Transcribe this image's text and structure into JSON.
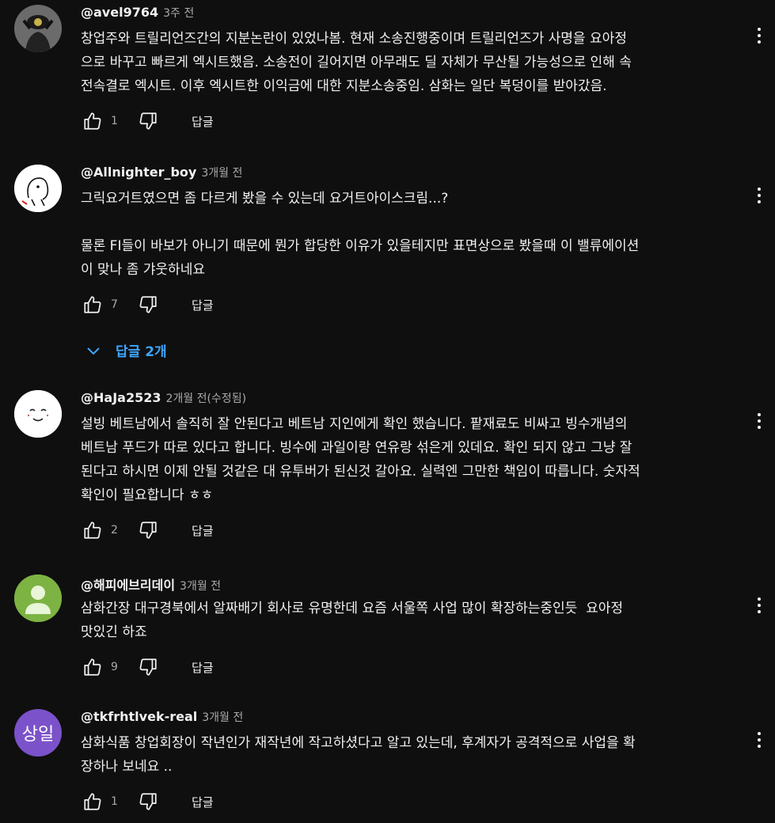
{
  "comments": [
    {
      "author": "@avel9764",
      "time": "3주 전",
      "text": "창업주와 트릴리언즈간의 지분논란이 있었나봄. 현재 소송진행중이며 트릴리언즈가 사명을 요아정\n으로 바꾸고 빠르게 엑시트했음. 소송전이 길어지면 아무래도 딜 자체가 무산될 가능성으로 인해 속\n전속결로 엑시트. 이후 엑시트한 이익금에 대한 지분소송중임. 삼화는 일단 복덩이를 받아갔음.",
      "likes": "1",
      "reply_label": "답글",
      "avatar_icon": "robot-figure-avatar"
    },
    {
      "author": "@Allnighter_boy",
      "time": "3개월 전",
      "text": "그릭요거트였으면 좀 다르게 봤을 수 있는데 요거트아이스크림...?\n\n물론 FI들이 바보가 아니기 때문에 뭔가 합당한 이유가 있을테지만 표면상으로 봤을때 이 밸류에이션\n이 맞나 좀 갸웃하네요",
      "likes": "7",
      "reply_label": "답글",
      "replies_label": "답글 2개",
      "avatar_icon": "doodle-character-avatar"
    },
    {
      "author": "@HaJa2523",
      "time": "2개월 전(수정됨)",
      "text": "설빙 베트남에서 솔직히 잘 안된다고 베트남 지인에게 확인 했습니다. 팥재료도 비싸고 빙수개념의\n베트남 푸드가 따로 있다고 합니다. 빙수에 과일이랑 연유랑 섞은게 있데요. 확인 되지 않고 그냥 잘\n된다고 하시면 이제 안될 것같은 대 유투버가 된신것 갈아요. 실력엔 그만한 책임이 따릅니다. 숫자적\n확인이 필요합니다 ㅎㅎ",
      "likes": "2",
      "reply_label": "답글",
      "avatar_icon": "smiley-face-avatar"
    },
    {
      "author": "@해피에브리데이",
      "time": "3개월 전",
      "text": "삼화간장 대구경북에서 알짜배기 회사로 유명한데 요즘 서울쪽 사업 많이 확장하는중인듯  요아정\n맛있긴 하죠",
      "likes": "9",
      "reply_label": "답글",
      "avatar_icon": "default-user-avatar"
    },
    {
      "author": "@tkfrhtlvek-real",
      "time": "3개월 전",
      "text": "삼화식품 창업회장이 작년인가 재작년에 작고하셨다고 알고 있는데, 후계자가 공격적으로 사업을 확\n장하나 보네요 ..",
      "likes": "1",
      "reply_label": "답글",
      "avatar_text": "상일",
      "avatar_color": "#7b52c9"
    }
  ]
}
